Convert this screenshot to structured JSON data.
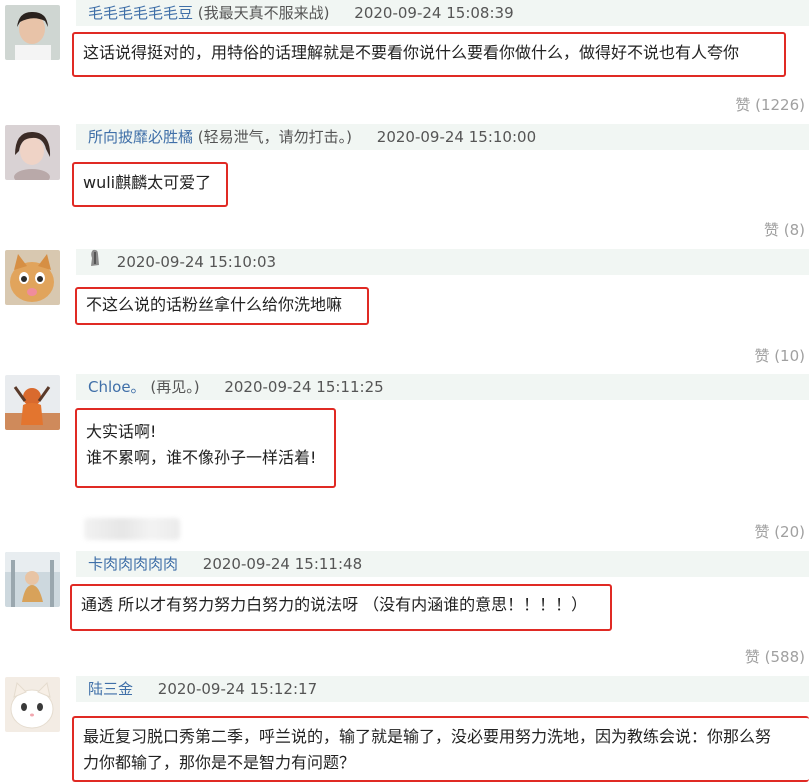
{
  "comments": [
    {
      "user": "毛毛毛毛毛毛豆",
      "note": "(我最天真不服来战)",
      "time": "2020-09-24 15:08:39",
      "lines": [
        "这话说得挺对的，用特俗的话理解就是不要看你说什么要看你做什么，做得好不说也有人夸你"
      ],
      "likes": "赞 (1226)"
    },
    {
      "user": "所向披靡必胜橘",
      "note": "(轻易泄气，请勿打击。)",
      "time": "2020-09-24 15:10:00",
      "lines": [
        "wuli麒麟太可爱了"
      ],
      "likes": "赞 (8)"
    },
    {
      "user": "",
      "note": "",
      "time": "2020-09-24 15:10:03",
      "lines": [
        "不这么说的话粉丝拿什么给你洗地嘛"
      ],
      "likes": "赞 (10)"
    },
    {
      "user": "Chloe。",
      "note": "(再见。)",
      "time": "2020-09-24 15:11:25",
      "lines": [
        "大实话啊!",
        "谁不累啊，谁不像孙子一样活着!"
      ],
      "likes": "赞 (20)"
    },
    {
      "user": "卡肉肉肉肉肉",
      "note": "",
      "time": "2020-09-24 15:11:48",
      "lines": [
        "通透 所以才有努力努力白努力的说法呀 （没有内涵谁的意思！！！！）"
      ],
      "likes": "赞 (588)"
    },
    {
      "user": "陆三金",
      "note": "",
      "time": "2020-09-24 15:12:17",
      "lines": [
        "最近复习脱口秀第二季，呼兰说的，输了就是输了，没必要用努力洗地，因为教练会说：你那么努",
        "力你都输了，那你是不是智力有问题？"
      ],
      "likes": ""
    }
  ],
  "colors": {
    "highlight_border": "#e02a24",
    "header_bg": "#f1f6f3",
    "username": "#3f6fa8",
    "like_text": "#a0a0a0"
  },
  "icons": {
    "comment3_badge": "figurine-icon"
  }
}
